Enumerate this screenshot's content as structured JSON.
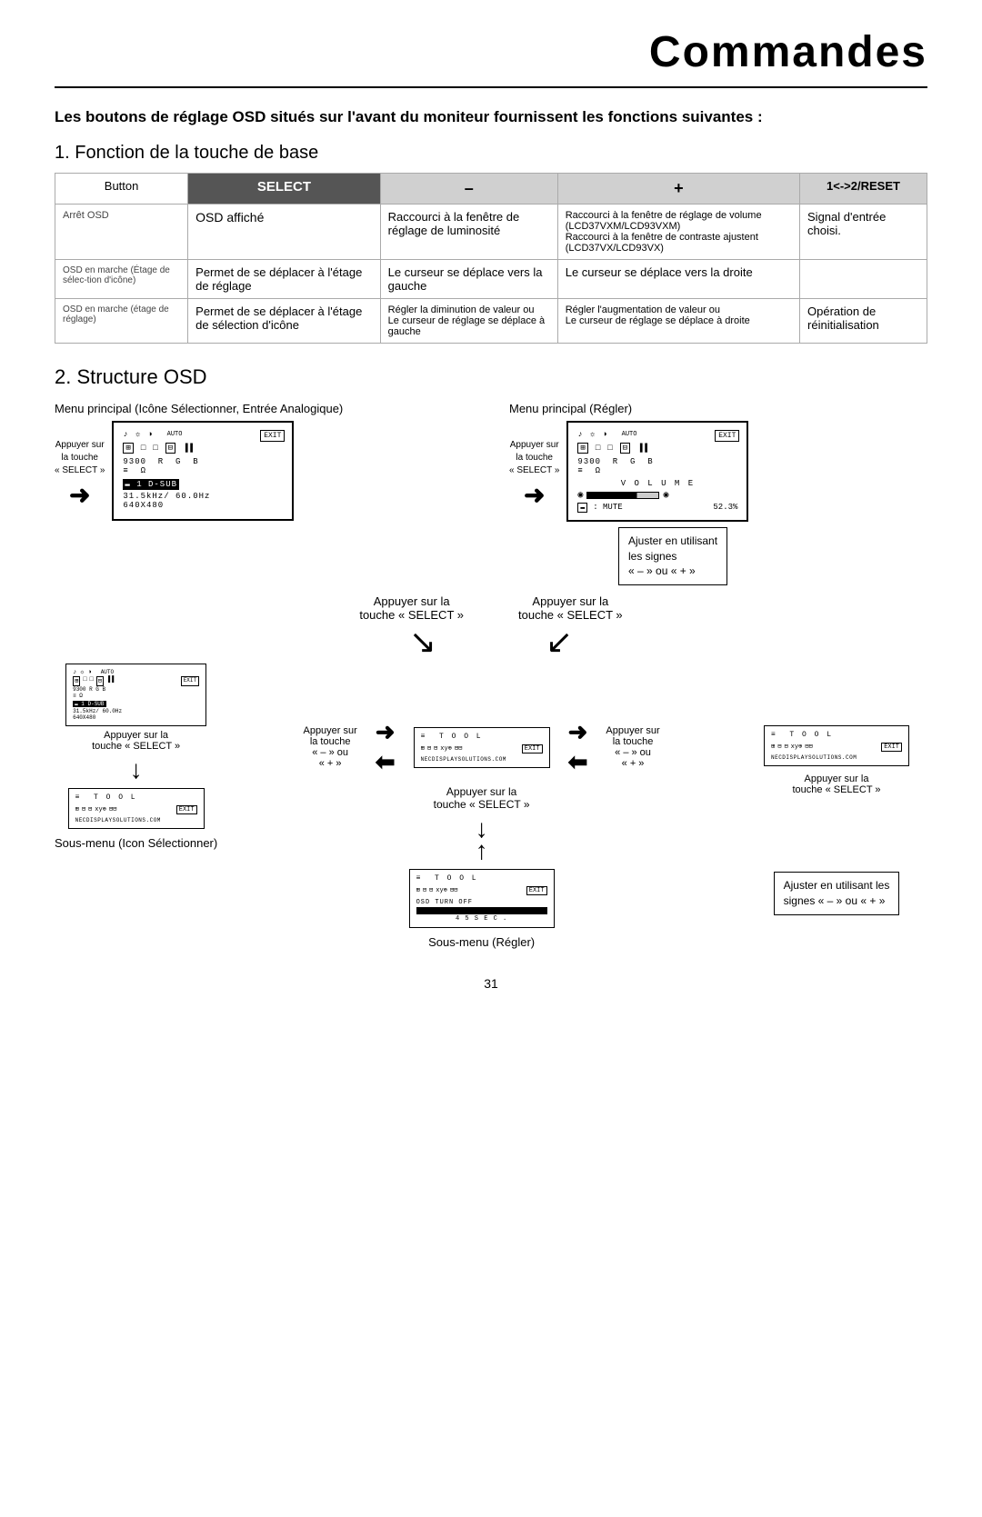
{
  "title": "Commandes",
  "intro": "Les boutons de réglage OSD situés sur l'avant du moniteur fournissent les fonctions suivantes :",
  "section1": {
    "heading": "1. Fonction de la touche de base",
    "table": {
      "headers": [
        "Button",
        "SELECT",
        "–",
        "+",
        "1<->2/RESET"
      ],
      "rows": [
        {
          "col1": "Arrêt OSD",
          "col2": "OSD affiché",
          "col3": "Raccourci à la fenêtre de réglage de luminosité",
          "col4": "Raccourci à la fenêtre de réglage de volume (LCD37VXM/LCD93VXM)\nRaccourci à la fenêtre de contraste ajustent (LCD37VX/LCD93VX)",
          "col5": "Signal d'entrée choisi."
        },
        {
          "col1": "OSD en marche (Étage de sélec-tion d'icône)",
          "col2": "Permet de se déplacer à l'étage de réglage",
          "col3": "Le curseur se déplace vers la gauche",
          "col4": "Le curseur se déplace vers la droite",
          "col5": ""
        },
        {
          "col1": "OSD en marche (étage de réglage)",
          "col2": "Permet de se déplacer à l'étage de sélection d'icône",
          "col3": "Régler la diminution de valeur ou\nLe curseur de réglage se déplace à gauche",
          "col4": "Régler l'augmentation de valeur ou\nLe curseur de réglage se déplace à droite",
          "col5": "Opération de réinitialisation"
        }
      ]
    }
  },
  "section2": {
    "heading": "2. Structure OSD",
    "main_menu_left_title": "Menu principal (Icône Sélectionner, Entrée Analogique)",
    "main_menu_right_title": "Menu principal (Régler)",
    "appuyer_select": "Appuyer sur\nla touche\n« SELECT »",
    "appuyer_select2": "Appuyer sur la\ntouche « SELECT »",
    "appuyer_select3": "Appuyer sur la\ntouche « SELECT »",
    "appuyer_select4": "Appuyer sur la\ntouche « SELECT »",
    "ajuster_label": "Ajuster en utilisant\nles signes\n« – » ou « + »",
    "ajuster_label2": "Ajuster en utilisant les\nsignes « – » ou « + »",
    "sous_menu_icon": "Sous-menu (Icon Sélectionner)",
    "sous_menu_regler": "Sous-menu (Régler)",
    "appuyer_touch_select_left": "Appuyer sur la\ntouche « SELECT »",
    "osd_main_left": {
      "icons": "♪ ☆ ◑  AUTO",
      "icons2": "⊞ □ □ ⊟ ▐▐",
      "freq": "9300  R  G  B",
      "line": "≡  Ω",
      "input_bar": "▬ 1  D-SUB",
      "freq2": "31.5kHz/ 60.0Hz",
      "res": "640X480",
      "exit": "EXIT"
    },
    "osd_main_right": {
      "icons": "♪ ☆ ◑  AUTO",
      "icons2": "⊞ □ □ ⊟ ▐▐",
      "freq": "9300  R  G  B",
      "line": "≡  Ω",
      "volume_title": "V O L U M E",
      "mute": ": MUTE",
      "vol_percent": "52.3%",
      "exit": "EXIT"
    },
    "tool_menu1": {
      "title": "≡  T O O L",
      "icons": "⊞ ⊟ ⊟ xy⊕ ⊟⊟",
      "exit": "EXIT",
      "url": "NECDISPLAYSOLUTIONS.COM"
    },
    "tool_menu2": {
      "title": "≡  T O O L",
      "icons": "⊞ ⊟ ⊟ xy⊕ ⊟⊟",
      "exit": "EXIT",
      "url": "NECDISPLAYSOLUTIONS.COM"
    },
    "tool_menu3": {
      "title": "≡  T O O L",
      "icons": "⊞ ⊟ ⊟ xy⊕ ⊟⊟",
      "exit": "EXIT",
      "url": "NECDISPLAYSOLUTIONS.COM",
      "osd_off": "OSD TURN OFF",
      "sec": "45SEC."
    },
    "appuyer_minus_ou": "Appuyer sur\nla touche\n« – » ou\n« + »",
    "appuyer_minus_ou2": "Appuyer sur\nla touche\n« – » ou\n« + »"
  },
  "page_number": "31"
}
